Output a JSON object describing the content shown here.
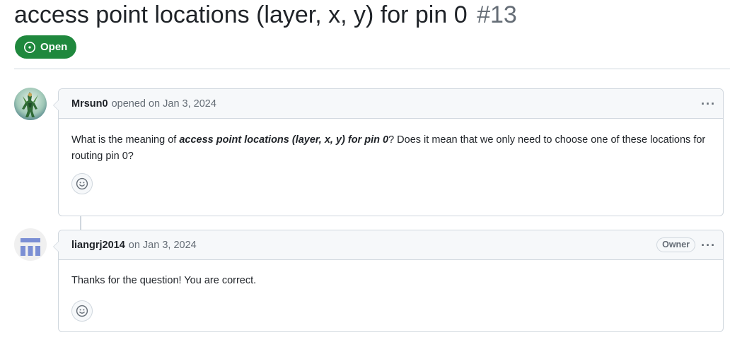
{
  "issue": {
    "title": "access point locations (layer, x, y) for pin 0",
    "number": "#13",
    "state": "Open",
    "state_color": "#1f883d"
  },
  "comments": [
    {
      "author": "Mrsun0",
      "action": "opened on Jan 3, 2024",
      "avatar_icon": "game-character-avatar",
      "body_prefix": "What is the meaning of ",
      "body_emphasis": "access point locations (layer, x, y) for pin 0",
      "body_suffix": "? Does it mean that we only need to choose one of these locations for routing pin 0?",
      "menu_label": "···",
      "reaction_icon": "smiley-icon"
    },
    {
      "author": "liangrj2014",
      "action": "on Jan 3, 2024",
      "avatar_icon": "identicon-avatar",
      "badge": "Owner",
      "body": "Thanks for the question! You are correct.",
      "menu_label": "···",
      "reaction_icon": "smiley-icon"
    }
  ],
  "colors": {
    "border": "#d0d7de",
    "header_bg": "#f6f8fa",
    "muted_text": "#656d76",
    "identicon": "#7b8fd4"
  }
}
